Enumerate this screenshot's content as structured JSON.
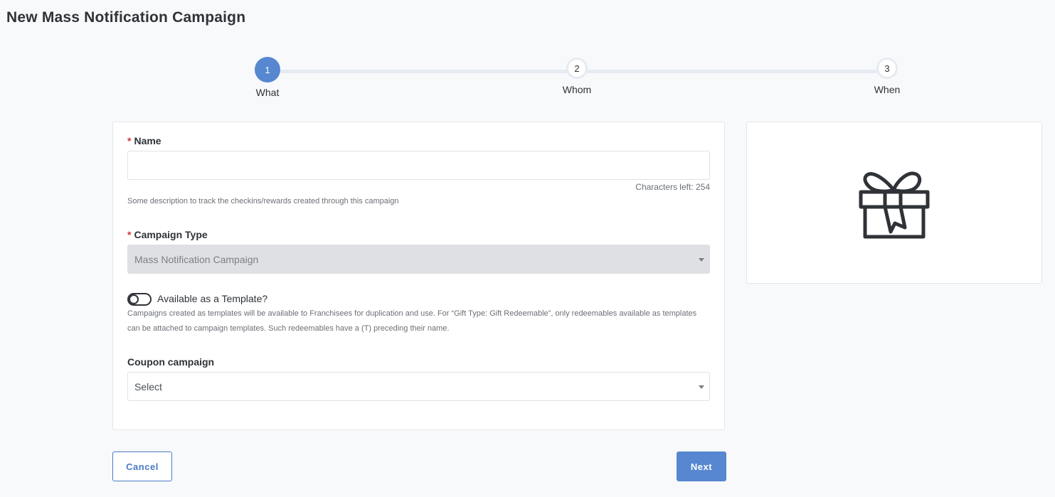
{
  "page": {
    "title": "New Mass Notification Campaign"
  },
  "stepper": {
    "current_step": 1,
    "steps": [
      {
        "number": "1",
        "label": "What"
      },
      {
        "number": "2",
        "label": "Whom"
      },
      {
        "number": "3",
        "label": "When"
      }
    ]
  },
  "form": {
    "name": {
      "required_mark": "*",
      "label": "Name",
      "value": "",
      "placeholder": "",
      "chars_left": "Characters left: 254",
      "help": "Some description to track the checkins/rewards created through this campaign"
    },
    "campaign_type": {
      "required_mark": "*",
      "label": "Campaign Type",
      "value": "Mass Notification Campaign",
      "disabled": true
    },
    "template_toggle": {
      "label": "Available as a Template?",
      "checked": false,
      "help": "Campaigns created as templates will be available to Franchisees for duplication and use. For “Gift Type: Gift Redeemable”, only redeemables available as templates can be attached to campaign templates. Such redeemables have a (T) preceding their name."
    },
    "coupon_campaign": {
      "label": "Coupon campaign",
      "value": "Select"
    }
  },
  "preview": {
    "icon": "gift-icon"
  },
  "actions": {
    "cancel_label": "Cancel",
    "next_label": "Next"
  },
  "colors": {
    "accent": "#5687d0",
    "required": "#d3343c",
    "step_track": "#e6ebf2"
  }
}
